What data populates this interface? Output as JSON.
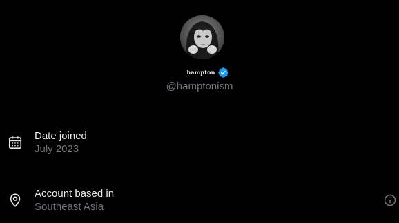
{
  "profile": {
    "display_name": "hampton",
    "handle": "@hamptonism",
    "avatar_icon": "profile-photo",
    "verified_icon": "verified-badge-icon",
    "verified_color": "#1d9bf0"
  },
  "details": {
    "date_joined": {
      "icon": "calendar-icon",
      "title": "Date joined",
      "value": "July 2023"
    },
    "account_based_in": {
      "icon": "location-pin-icon",
      "title": "Account based in",
      "value": "Southeast Asia",
      "info_icon": "info-icon"
    }
  },
  "colors": {
    "background": "#000000",
    "primary_text": "#e7e9ea",
    "secondary_text": "#71767b",
    "accent": "#1d9bf0"
  }
}
